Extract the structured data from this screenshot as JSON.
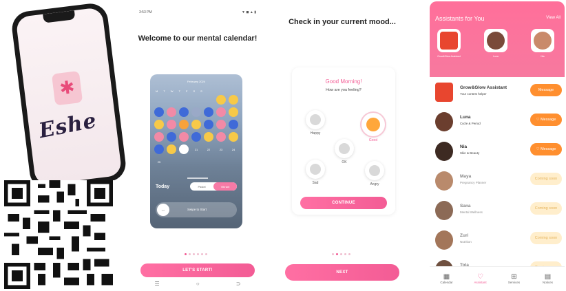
{
  "brand": {
    "logo_text": "Eshe",
    "logo_glyph": "✱",
    "accent": "#f35c95",
    "orange": "#ff8f2f"
  },
  "screen_calendar": {
    "status_time": "3:53 PM",
    "status_icons": "▼ ◼ ▲ ▮",
    "title": "Welcome to our mental calendar!",
    "month": "February 2024",
    "weekdays": [
      "M",
      "T",
      "W",
      "T",
      "F",
      "S",
      "S"
    ],
    "days": [
      {
        "d": "",
        "c": "transparent"
      },
      {
        "d": "",
        "c": "transparent"
      },
      {
        "d": "",
        "c": "transparent"
      },
      {
        "d": "",
        "c": "transparent"
      },
      {
        "d": "",
        "c": "transparent"
      },
      {
        "d": "",
        "c": "#f7c948"
      },
      {
        "d": "",
        "c": "#f7c948"
      },
      {
        "d": "",
        "c": "#3f6ad8"
      },
      {
        "d": "",
        "c": "#f28aa6"
      },
      {
        "d": "",
        "c": "#3f6ad8"
      },
      {
        "d": "",
        "c": "#9aa9c7"
      },
      {
        "d": "",
        "c": "#3f6ad8"
      },
      {
        "d": "",
        "c": "#f28aa6"
      },
      {
        "d": "",
        "c": "#f7c948"
      },
      {
        "d": "",
        "c": "#f7c948"
      },
      {
        "d": "",
        "c": "#f28aa6"
      },
      {
        "d": "",
        "c": "#f7a23b"
      },
      {
        "d": "",
        "c": "#f7c948"
      },
      {
        "d": "",
        "c": "#3f6ad8"
      },
      {
        "d": "",
        "c": "#f28aa6"
      },
      {
        "d": "",
        "c": "#3f6ad8"
      },
      {
        "d": "",
        "c": "#f28aa6"
      },
      {
        "d": "",
        "c": "#3f6ad8"
      },
      {
        "d": "",
        "c": "#f28aa6"
      },
      {
        "d": "",
        "c": "#3f6ad8"
      },
      {
        "d": "",
        "c": "#f7c948"
      },
      {
        "d": "",
        "c": "#f28aa6"
      },
      {
        "d": "",
        "c": "#f7c948"
      },
      {
        "d": "",
        "c": "#3f6ad8"
      },
      {
        "d": "",
        "c": "#f7c948"
      },
      {
        "d": "",
        "c": "#ffffff"
      },
      {
        "d": "21",
        "c": "transparent"
      },
      {
        "d": "22",
        "c": "transparent"
      },
      {
        "d": "23",
        "c": "transparent"
      },
      {
        "d": "24",
        "c": "transparent"
      },
      {
        "d": "25",
        "c": "transparent"
      }
    ],
    "today_label": "Today",
    "seg_left": "Pastel",
    "seg_right": "Vibrant",
    "swipe_knob": "<<",
    "swipe_text": "Swipe to Start",
    "cta": "LET'S START!",
    "nav": [
      "☰",
      "○",
      "⊃"
    ]
  },
  "screen_mood": {
    "title": "Check in your current mood...",
    "greeting": "Good Morning!",
    "question": "How are you feeling?",
    "moods": [
      {
        "label": "Happy"
      },
      {
        "label": "Good"
      },
      {
        "label": "OK"
      },
      {
        "label": "Sad"
      },
      {
        "label": "Angry"
      }
    ],
    "continue": "CONTINUE",
    "next": "NEXT"
  },
  "screen_assistants": {
    "header_title": "Assistants for You",
    "view_all": "View All",
    "featured": [
      {
        "name": "Grow&Glow Assistant",
        "color": "#e8462f"
      },
      {
        "name": "Luna",
        "color": "#7a4a3a"
      },
      {
        "name": "Nia",
        "color": "#c98a6a"
      }
    ],
    "rows": [
      {
        "name": "Grow&Glow Assistant",
        "sub": "Your contest helper",
        "btn": "Message",
        "color": "#e8462f",
        "soon": false
      },
      {
        "name": "Luna",
        "sub": "Cycle & Period",
        "btn": "♡ Message",
        "color": "#6b3e2e",
        "soon": false
      },
      {
        "name": "Nia",
        "sub": "Skin & Beauty",
        "btn": "♡ Message",
        "color": "#3d2a22",
        "soon": false
      },
      {
        "name": "Maya",
        "sub": "Pregnancy Planner",
        "btn": "Coming soon",
        "color": "#b98a6c",
        "soon": true
      },
      {
        "name": "Sana",
        "sub": "Mental Wellness",
        "btn": "Coming soon",
        "color": "#8c6a56",
        "soon": true
      },
      {
        "name": "Zuri",
        "sub": "Nutrition",
        "btn": "Coming soon",
        "color": "#a3765a",
        "soon": true
      },
      {
        "name": "Tola",
        "sub": "",
        "btn": "Coming soon",
        "color": "#6f5040",
        "soon": true
      }
    ],
    "tabs": [
      {
        "icon": "▦",
        "label": "Calendar"
      },
      {
        "icon": "♡",
        "label": "Assistant"
      },
      {
        "icon": "⊞",
        "label": "Services"
      },
      {
        "icon": "▤",
        "label": "Notices"
      }
    ]
  }
}
